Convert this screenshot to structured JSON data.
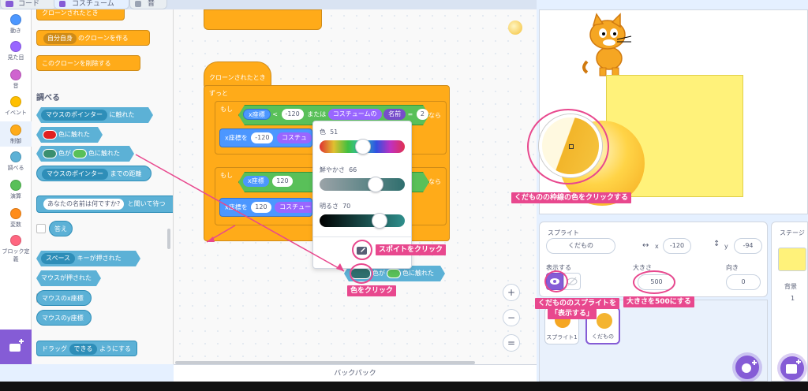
{
  "tabs": [
    {
      "label": "コード",
      "icon": "code-icon"
    },
    {
      "label": "コスチューム",
      "icon": "brush-icon"
    },
    {
      "label": "音",
      "icon": "speaker-icon"
    }
  ],
  "categories": [
    {
      "label": "動き",
      "color": "#4c97ff"
    },
    {
      "label": "見た目",
      "color": "#9966ff"
    },
    {
      "label": "音",
      "color": "#cf63cf"
    },
    {
      "label": "イベント",
      "color": "#ffbf00"
    },
    {
      "label": "制御",
      "color": "#ffab19"
    },
    {
      "label": "調べる",
      "color": "#5cb1d6"
    },
    {
      "label": "演算",
      "color": "#59c059"
    },
    {
      "label": "変数",
      "color": "#ff8c1a"
    },
    {
      "label": "ブロック定義",
      "color": "#ff6680"
    }
  ],
  "palette": {
    "top_partial": "クローンされたとき",
    "clone_create": "自分自身",
    "clone_create_suffix": "のクローンを作る",
    "clone_delete": "このクローンを削除する",
    "section_heading": "調べる",
    "touching_object": "マウスのポインター",
    "touching_suffix": "に触れた",
    "touching_color": "色に触れた",
    "color_is_touching_a": "色が",
    "color_is_touching_b": "色に触れた",
    "distance_target": "マウスのポインター",
    "distance_suffix": "までの距離",
    "ask_prompt": "あなたの名前は何ですか?",
    "ask_suffix": "と聞いて待つ",
    "answer": "答え",
    "key_name": "スペース",
    "key_suffix": "キーが押された",
    "mouse_down": "マウスが押された",
    "mouse_x": "マウスのx座標",
    "mouse_y": "マウスのy座標",
    "drag_prefix": "ドラッグ",
    "drag_mode": "できる",
    "drag_suffix": "ようにする"
  },
  "code": {
    "hat": "クローンされたとき",
    "forever": "ずっと",
    "if1": "もし",
    "x_pos": "x座標",
    "lt": "<",
    "n_neg120": "-120",
    "or": "または",
    "costume_of": "コスチュームの",
    "name": "名前",
    "eq": "=",
    "n2": "2",
    "then": "なら",
    "set_x": "x座標を",
    "costume_partial": "コスチュ",
    "if2": "もし",
    "n120": "120",
    "n120b": "120",
    "costume_partial2": "コスチュー",
    "then2": "なら",
    "dropped_a": "色が",
    "dropped_b": "色に触れた"
  },
  "picker": {
    "hue_label": "色",
    "hue_value": "51",
    "hue_fraction": 0.51,
    "sat_label": "鮮やかさ",
    "sat_value": "66",
    "sat_fraction": 0.66,
    "bright_label": "明るさ",
    "bright_value": "70",
    "bright_fraction": 0.7
  },
  "annotations": {
    "eyedropper": "スポイトをクリック",
    "click_color": "色をクリック",
    "outline_color": "くだものの枠線の色をクリックする",
    "show_sprite_1": "くだもののスプライトを",
    "show_sprite_2": "「表示する」",
    "size_500": "大きさを500にする"
  },
  "sprite": {
    "header": "スプライト",
    "name": "くだもの",
    "x_label": "x",
    "x_value": "-120",
    "y_label": "y",
    "y_value": "-94",
    "show_label": "表示する",
    "size_label": "大きさ",
    "size_value": "500",
    "direction_label": "向き",
    "direction_value": "0",
    "sprites": [
      "スプライト1",
      "くだもの"
    ]
  },
  "stage_pane": {
    "header": "ステージ",
    "backdrop_label": "背景",
    "backdrop_count": "1"
  },
  "backpack": "バックパック",
  "zoom": [
    "+",
    "−",
    "="
  ]
}
